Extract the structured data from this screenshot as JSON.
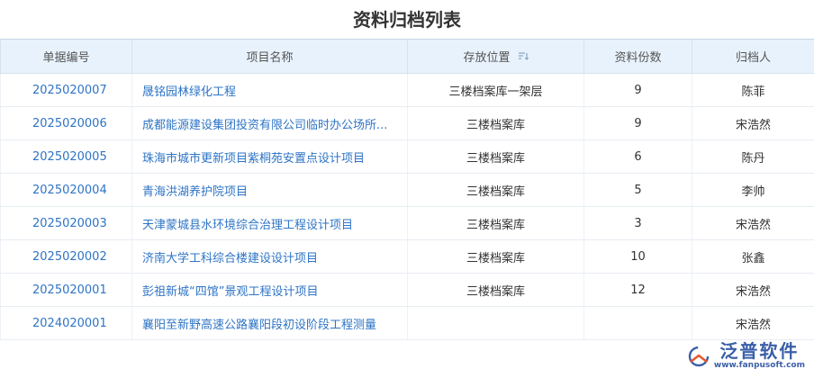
{
  "title": "资料归档列表",
  "columns": [
    "单据编号",
    "项目名称",
    "存放位置",
    "资料份数",
    "归档人"
  ],
  "rows": [
    {
      "no": "2025020007",
      "name": "晟铭园林绿化工程",
      "loc": "三楼档案库一架层",
      "count": "9",
      "person": "陈菲"
    },
    {
      "no": "2025020006",
      "name": "成都能源建设集团投资有限公司临时办公场所...",
      "loc": "三楼档案库",
      "count": "9",
      "person": "宋浩然"
    },
    {
      "no": "2025020005",
      "name": "珠海市城市更新项目紫桐苑安置点设计项目",
      "loc": "三楼档案库",
      "count": "6",
      "person": "陈丹"
    },
    {
      "no": "2025020004",
      "name": "青海洪湖养护院项目",
      "loc": "三楼档案库",
      "count": "5",
      "person": "李帅"
    },
    {
      "no": "2025020003",
      "name": "天津蒙城县水环境综合治理工程设计项目",
      "loc": "三楼档案库",
      "count": "3",
      "person": "宋浩然"
    },
    {
      "no": "2025020002",
      "name": "济南大学工科综合楼建设设计项目",
      "loc": "三楼档案库",
      "count": "10",
      "person": "张鑫"
    },
    {
      "no": "2025020001",
      "name": "彭祖新城“四馆”景观工程设计项目",
      "loc": "三楼档案库",
      "count": "12",
      "person": "宋浩然"
    },
    {
      "no": "2024020001",
      "name": "襄阳至新野高速公路襄阳段初设阶段工程测量",
      "loc": "",
      "count": "",
      "person": "宋浩然"
    }
  ],
  "logo": {
    "name": "泛普软件",
    "url": "www.fanpusoft.com"
  },
  "colors": {
    "link": "#2e74c6",
    "header_bg": "#e8f2fc",
    "logo": "#3a5fa8",
    "logo_accent": "#e8542b"
  },
  "icons": {
    "sort": "sort-descending-icon",
    "logo": "fanpu-logo-icon"
  }
}
